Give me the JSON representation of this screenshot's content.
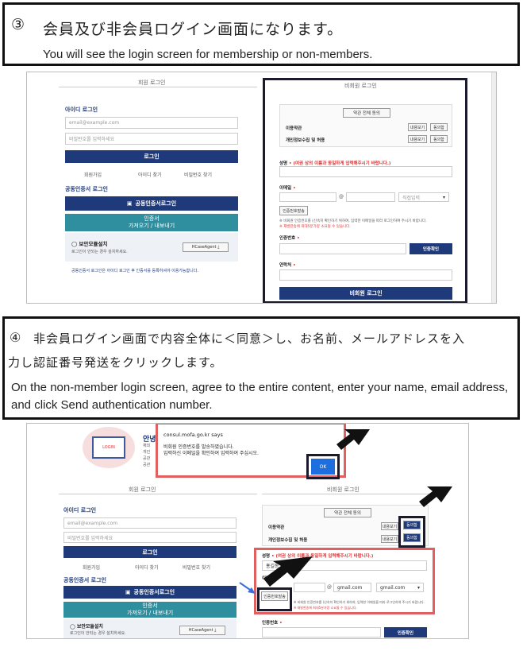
{
  "step3": {
    "circle": "③",
    "jp": "会員及び非会員ログイン画面になります。",
    "en": "You will see the login screen for membership or non-members."
  },
  "step4": {
    "circle": "④",
    "jp1": "非会員ログイン画面で内容全体に＜同意＞し、お名前、メールアドレスを入",
    "jp2": "力し認証番号発送をクリックします。",
    "en": "On the non-member login screen, agree to the entire content, enter your name, email address, and click Send authentication number."
  },
  "member": {
    "tab": "회원 로그인",
    "id_title": "아이디 로그인",
    "email_ph": "email@example.com",
    "pw_ph": "비밀번호를 입력하세요",
    "login_btn": "로그인",
    "links": [
      "회원가입",
      "아이디 찾기",
      "비밀번호 찾기"
    ],
    "cert_title": "공동인증서 로그인",
    "cert_btn": "공동인증서로그인",
    "cert_sub1": "인증서",
    "cert_sub2": "가져오기 / 내보내기",
    "security_title": "보안모듈설치",
    "security_desc": "로그인이 안되는 경우 설치하세요.",
    "hcase": "HCaseAgent",
    "footnote": "공동인증서 로그인은 아이디 로그인 후 인증서를 등록하셔야 이용가능합니다."
  },
  "nonmember": {
    "tab": "비회원 로그인",
    "agree_all": "약관 전체 동의",
    "terms": [
      {
        "label": "이용약관",
        "view": "내용보기",
        "agree": "동의함"
      },
      {
        "label": "개인정보수집 및 허용",
        "view": "내용보기",
        "agree": "동의함"
      }
    ],
    "name_label": "성명",
    "name_note": "(여권 상의 이름과 동일하게 입력해주시기 바랍니다.)",
    "name_value": "홍길동",
    "email_label": "이메일",
    "at": "@",
    "domain_ph": "직접입력",
    "email_user": "gmail.com",
    "domain_value": "gmail.com",
    "send_btn": "인증번호발송",
    "send_note": "※ 비회원 인증번호를 (신속히 확인하기 위하여, 입력한 이메일을 따라 로그인하여 주시기 바랍니다.",
    "send_warn": "※ 재발한송에 최대5분가량 소요될 수 있습니다.",
    "auth_label": "인증번호",
    "auth_btn": "인증확인",
    "contact_label": "연락처",
    "login_btn": "비회원 로그인"
  },
  "dialog": {
    "title": "consul.mofa.go.kr says",
    "line1": "비회원 인증번호를 발송하였습니다.",
    "line2": "입력하신 이메일을 확인하여 입력하여 주십시오.",
    "ok": "OK"
  },
  "partial_header": {
    "title": "안녕",
    "lines": [
      "재외",
      "개인",
      "공관",
      "공관"
    ],
    "monitor_text": "LOGIN"
  },
  "colors": {
    "navy": "#1f3a7a",
    "teal": "#2f8f9f",
    "red_outline": "#e06060"
  }
}
